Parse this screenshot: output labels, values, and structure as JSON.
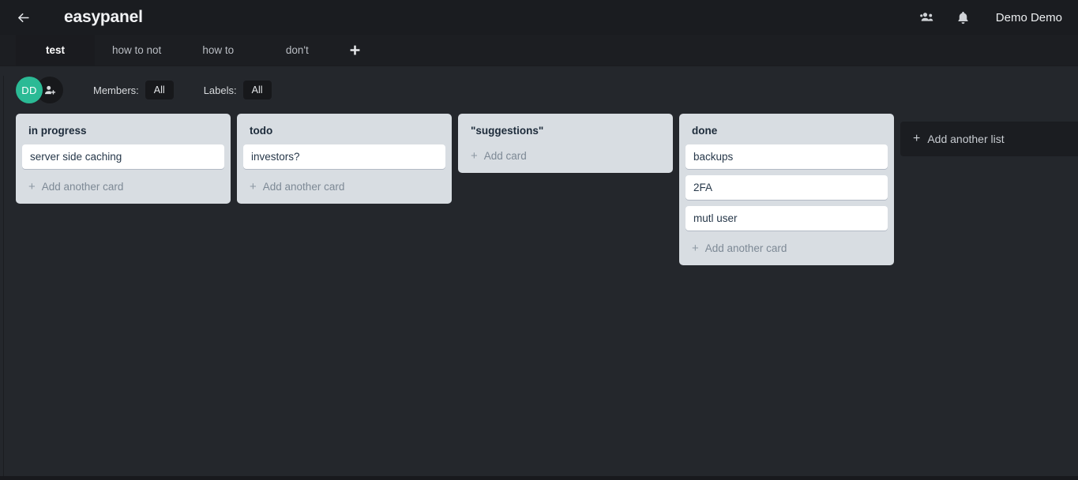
{
  "header": {
    "back_icon": "arrow-left-icon",
    "title": "easypanel",
    "members_icon": "people-group-icon",
    "notifications_icon": "bell-icon",
    "user_name": "Demo Demo"
  },
  "tabs": {
    "items": [
      {
        "label": "test",
        "active": true
      },
      {
        "label": "how to not",
        "active": false
      },
      {
        "label": "how to",
        "active": false
      },
      {
        "label": "don't",
        "active": false
      }
    ],
    "add_label": "+"
  },
  "filterbar": {
    "avatar_initials": "DD",
    "avatar_color": "#2bba95",
    "add_member_icon": "add-person-icon",
    "members_label": "Members:",
    "members_value": "All",
    "labels_label": "Labels:",
    "labels_value": "All"
  },
  "board": {
    "lists": [
      {
        "title": "in progress",
        "cards": [
          "server side caching"
        ],
        "add_card_label": "Add another card"
      },
      {
        "title": "todo",
        "cards": [
          "investors?"
        ],
        "add_card_label": "Add another card"
      },
      {
        "title": "\"suggestions\"",
        "cards": [],
        "add_card_label": "Add card"
      },
      {
        "title": "done",
        "cards": [
          "backups",
          "2FA",
          "mutl user"
        ],
        "add_card_label": "Add another card"
      }
    ],
    "add_list_label": "Add another list"
  }
}
